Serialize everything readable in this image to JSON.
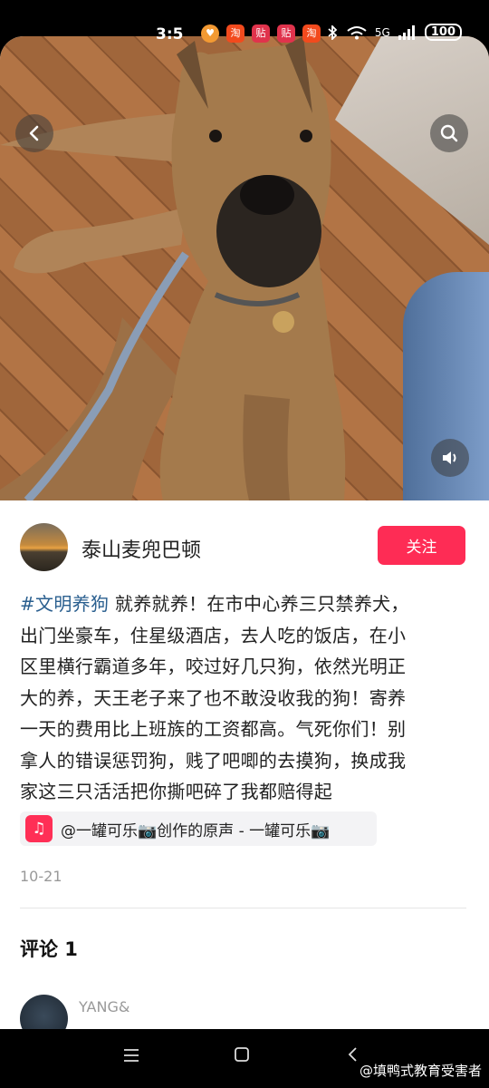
{
  "status_bar": {
    "time": "3:5",
    "apps": [
      {
        "icon": "heart-app-icon",
        "text": "♥"
      },
      {
        "icon": "taobao-app-icon",
        "text": "淘"
      },
      {
        "icon": "tie-app-icon",
        "text": "贴"
      },
      {
        "icon": "tie-app-icon",
        "text": "贴"
      },
      {
        "icon": "taobao-app-icon",
        "text": "淘"
      }
    ],
    "network": "5G",
    "battery": "100"
  },
  "post": {
    "author": "泰山麦兜巴顿",
    "follow_label": "关注",
    "hashtag": "#文明养狗",
    "text_lines": [
      " 就养就养！在市中心养三只禁养犬，",
      "出门坐豪车，住星级酒店，去人吃的饭店，在小",
      "区里横行霸道多年，咬过好几只狗，依然光明正",
      "大的养，天王老子来了也不敢没收我的狗！寄养",
      "一天的费用比上班族的工资都高。气死你们！别",
      "拿人的错误惩罚狗，贱了吧唧的去摸狗，换成我",
      "家这三只活活把你撕吧碎了我都赔得起"
    ],
    "music": "@一罐可乐📷创作的原声 - 一罐可乐📷",
    "date": "10-21"
  },
  "comments": {
    "title": "评论 1",
    "first_user": "YANG&"
  },
  "watermark": "@填鸭式教育受害者",
  "colors": {
    "accent": "#fe2c55",
    "hashtag": "#2a5f8f"
  }
}
